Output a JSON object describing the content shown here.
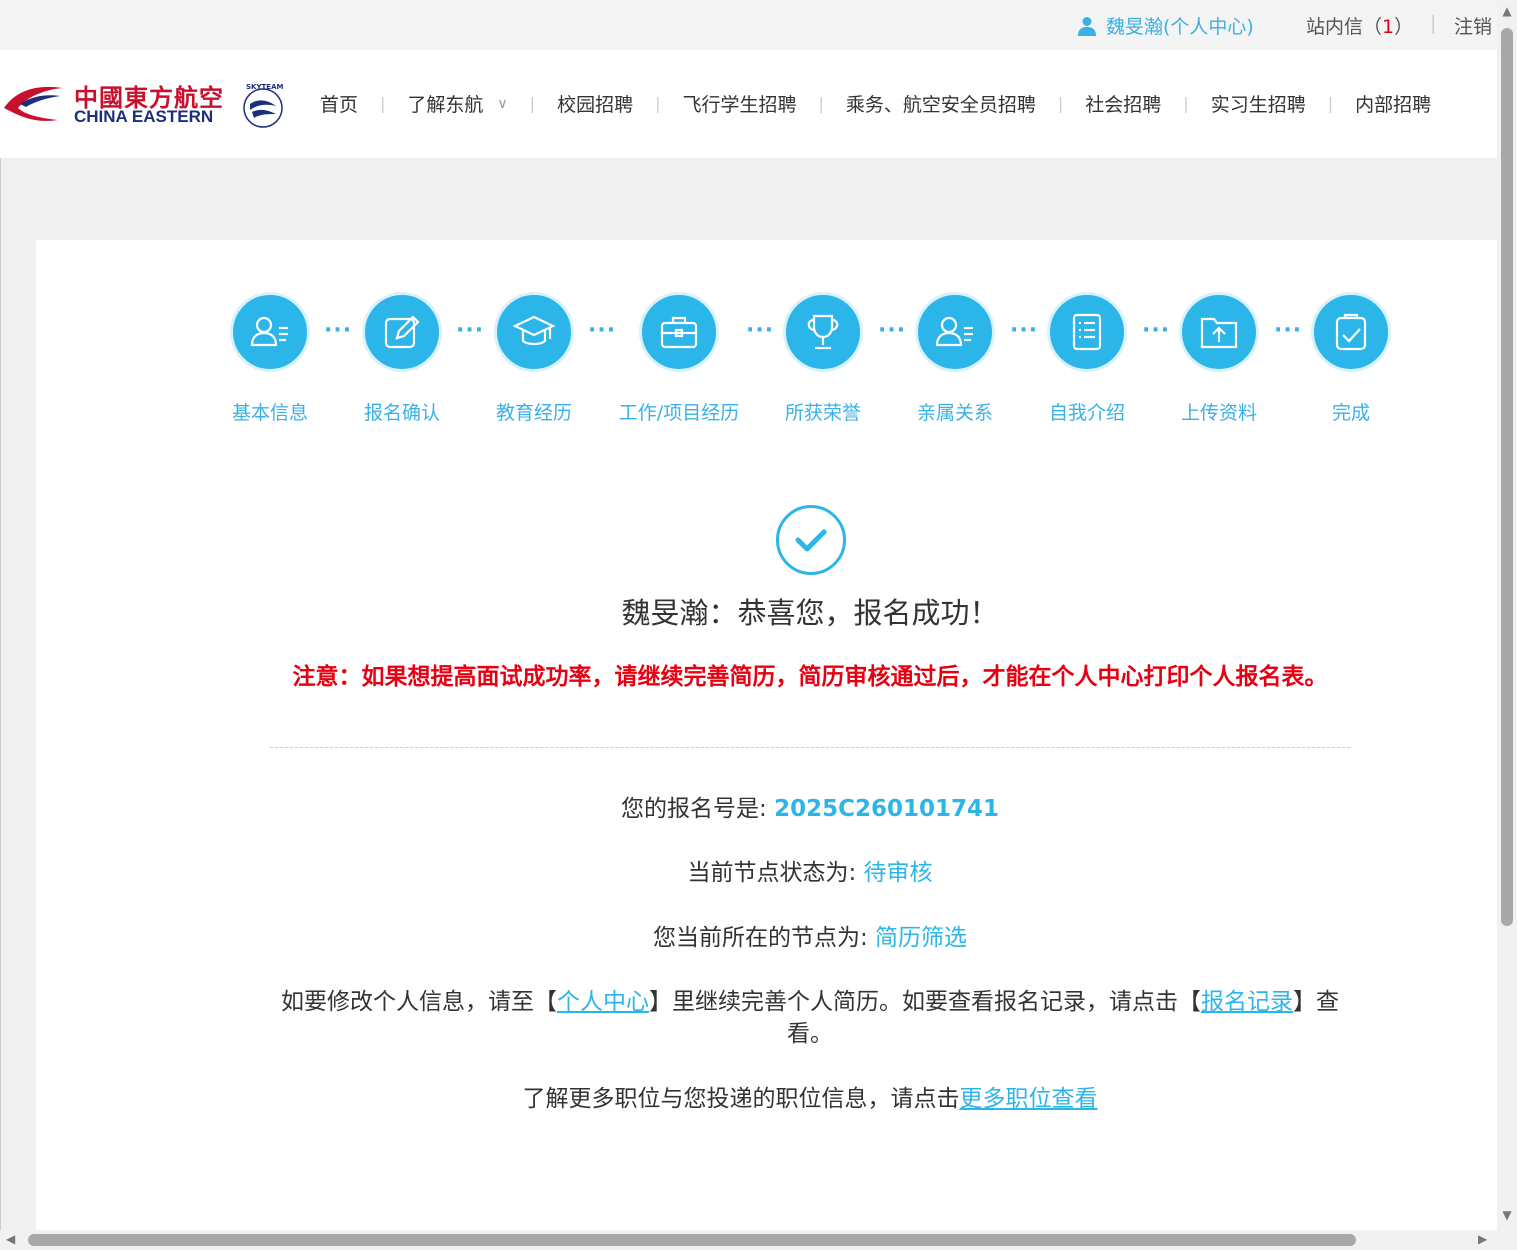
{
  "topbar": {
    "user_label": "魏旻瀚(个人中心)",
    "messages_label": "站内信（",
    "messages_count": "1",
    "messages_close": "）",
    "separator": "|",
    "logout_label": "注销"
  },
  "logo": {
    "cn": "中國東方航空",
    "en": "CHINA EASTERN",
    "skyteam": "SKYTEAM"
  },
  "nav": {
    "items": [
      "首页",
      "了解东航",
      "校园招聘",
      "飞行学生招聘",
      "乘务、航空安全员招聘",
      "社会招聘",
      "实习生招聘",
      "内部招聘"
    ]
  },
  "steps": [
    {
      "label": "基本信息",
      "icon": "user-card-icon"
    },
    {
      "label": "报名确认",
      "icon": "edit-icon"
    },
    {
      "label": "教育经历",
      "icon": "graduation-cap-icon"
    },
    {
      "label": "工作/项目经历",
      "icon": "briefcase-icon"
    },
    {
      "label": "所获荣誉",
      "icon": "trophy-icon"
    },
    {
      "label": "亲属关系",
      "icon": "user-card-icon"
    },
    {
      "label": "自我介绍",
      "icon": "document-list-icon"
    },
    {
      "label": "上传资料",
      "icon": "upload-folder-icon"
    },
    {
      "label": "完成",
      "icon": "clipboard-check-icon"
    }
  ],
  "result": {
    "congrats": "魏旻瀚：恭喜您，报名成功！",
    "notice": "注意：如果想提高面试成功率，请继续完善简历，简历审核通过后，才能在个人中心打印个人报名表。",
    "reg_no_label": "您的报名号是: ",
    "reg_no_value": "2025C260101741",
    "status_label": "当前节点状态为: ",
    "status_value": "待审核",
    "node_label": "您当前所在的节点为: ",
    "node_value": "简历筛选",
    "modify_prefix": "如要修改个人信息，请至【",
    "modify_link": "个人中心",
    "modify_middle": "】里继续完善个人简历。如要查看报名记录，请点击【",
    "records_link": "报名记录",
    "modify_suffix": "】查看。",
    "more_prefix": "了解更多职位与您投递的职位信息，请点击",
    "more_link": "更多职位查看"
  },
  "colors": {
    "accent": "#2cb5e8",
    "warning": "#e60012",
    "brand_red": "#c8102e",
    "brand_blue": "#1b2f7c"
  }
}
